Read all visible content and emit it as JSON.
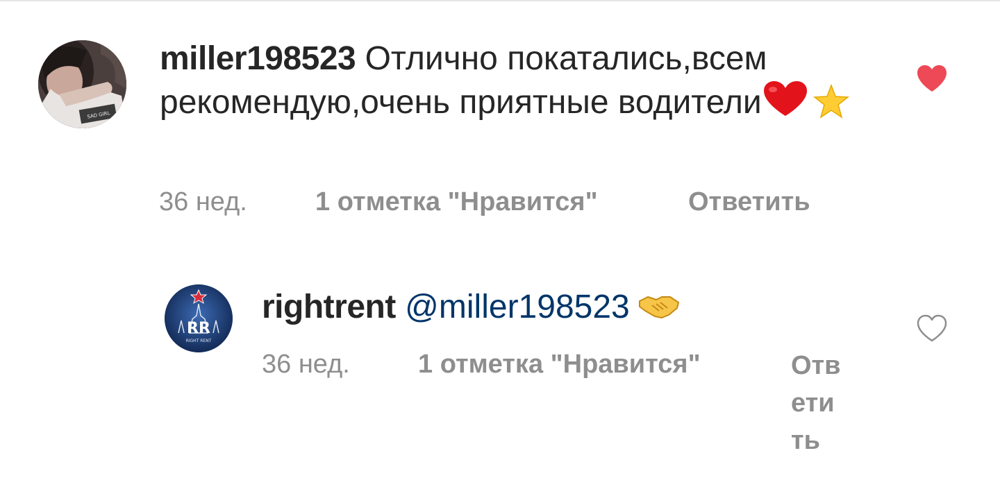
{
  "comments": [
    {
      "username": "miller198523",
      "text": " Отлично покатались,всем рекомендую,очень приятные водители",
      "emoji": [
        "red-heart",
        "star"
      ],
      "time": "36 нед.",
      "likes_label": "1 отметка \"Нравится\"",
      "reply_label": "Ответить",
      "liked": true,
      "avatar_icon": "user-photo-avatar"
    },
    {
      "username": "rightrent",
      "mention": "@miller198523",
      "emoji": [
        "handshake"
      ],
      "time": "36 нед.",
      "likes_label": "1 отметка \"Нравится\"",
      "reply_label": "Ответить",
      "liked": false,
      "avatar_icon": "rightrent-logo-avatar",
      "avatar_logo_text": "RR",
      "avatar_logo_subtext": "RIGHT RENT"
    }
  ],
  "colors": {
    "text": "#262626",
    "meta": "#8e8e8e",
    "mention": "#003569",
    "like_active": "#ed4956",
    "like_outline": "#8e8e8e"
  }
}
